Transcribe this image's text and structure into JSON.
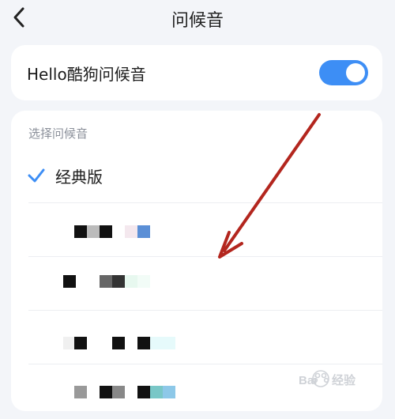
{
  "header": {
    "title": "问候音"
  },
  "greeting_toggle": {
    "label": "Hello酷狗问候音",
    "enabled": true
  },
  "selection": {
    "section_label": "选择问候音",
    "selected_option": "经典版"
  },
  "colors": {
    "accent": "#3d8ef5",
    "check": "#3d8ef5",
    "annotation_arrow": "#b3261e",
    "background": "#f3f5f9"
  },
  "icons": {
    "back": "chevron-left-icon",
    "check": "checkmark-icon",
    "annotation": "arrow-annotation-icon"
  }
}
